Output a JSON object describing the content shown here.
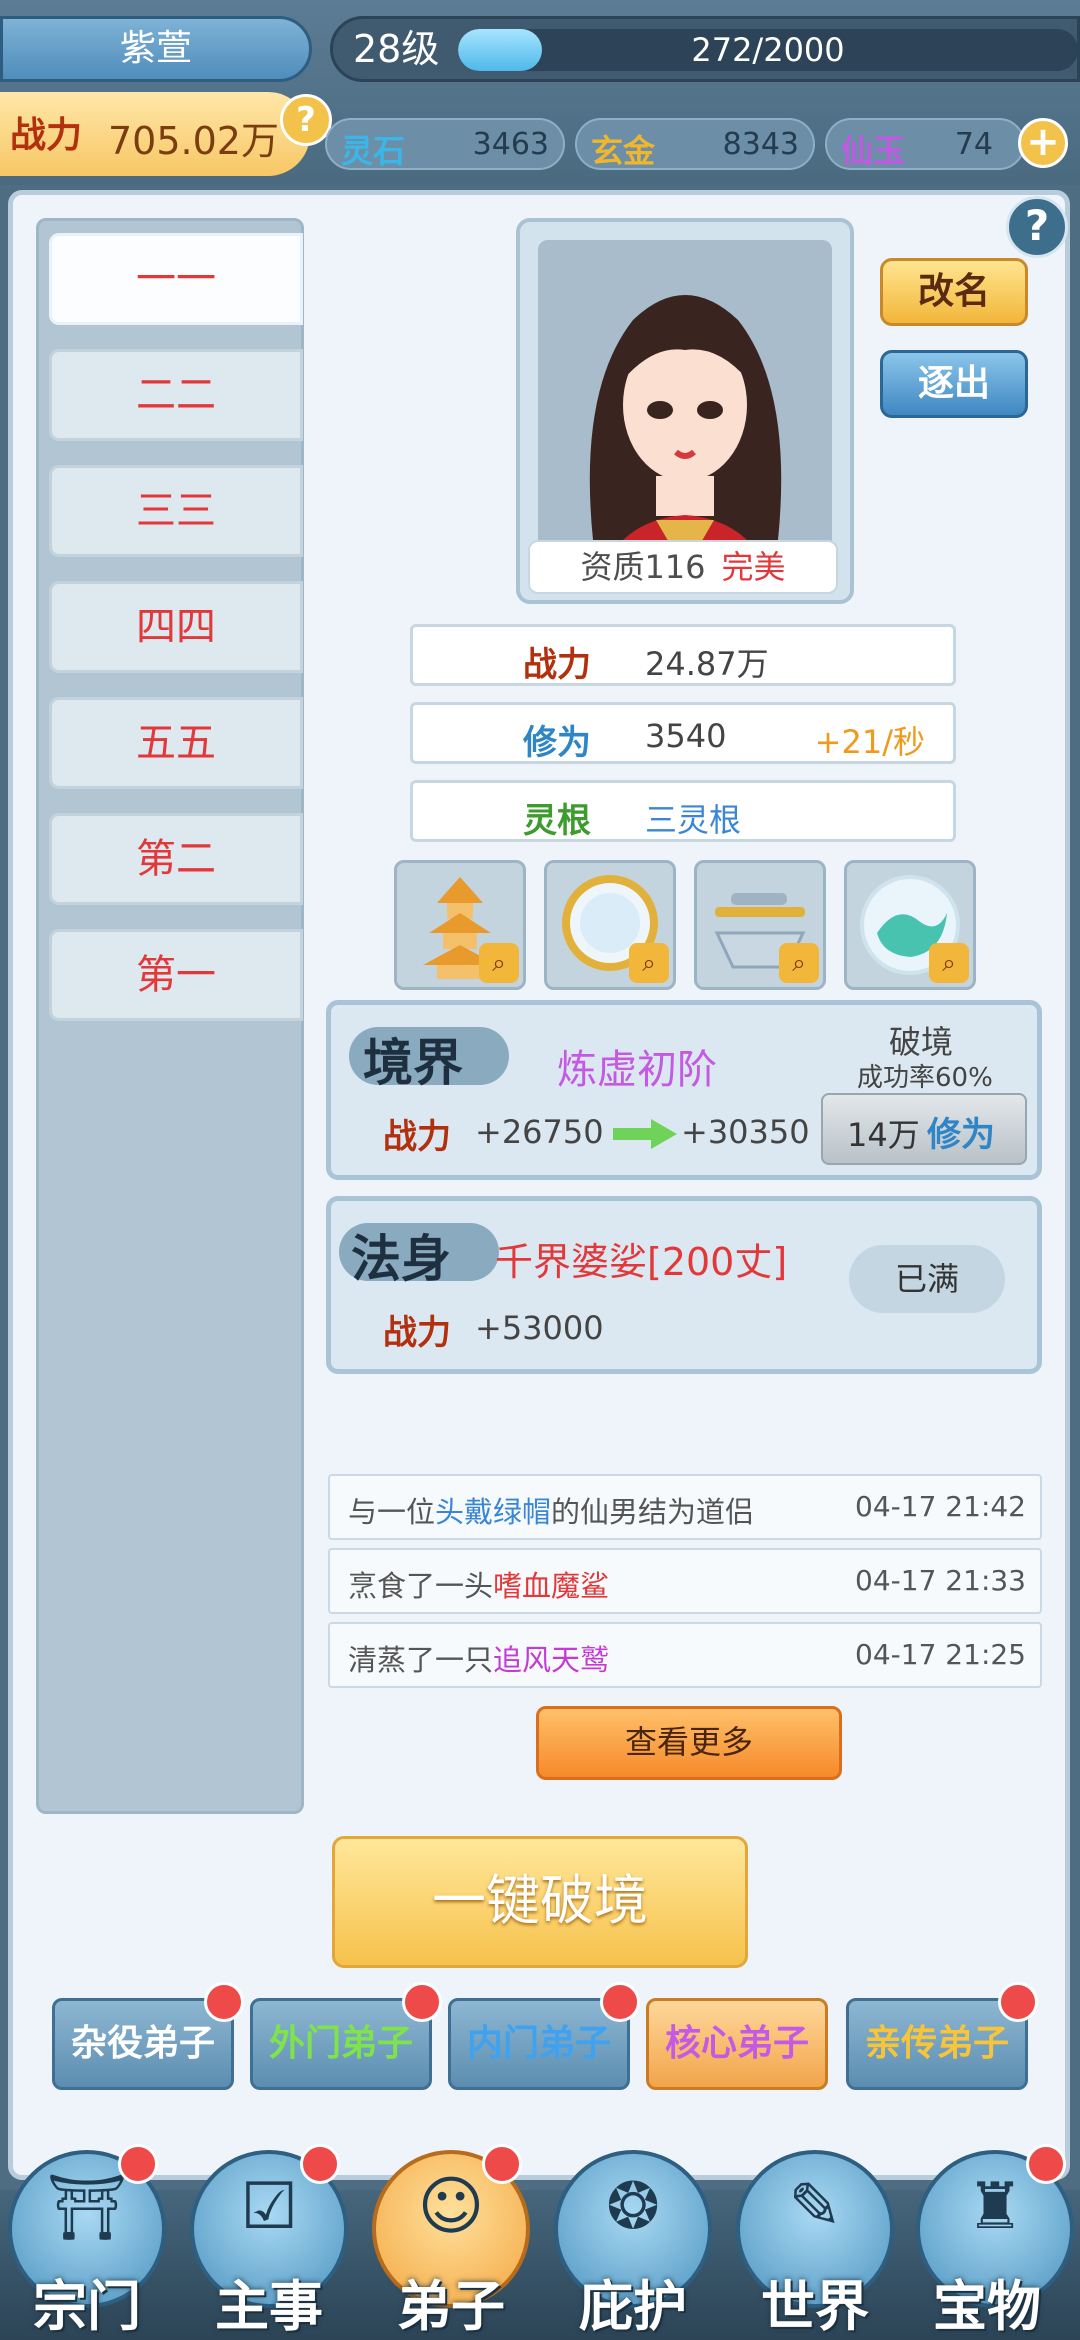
{
  "header": {
    "disciple_name": "紫萱",
    "level": "28级",
    "exp_text": "272/2000",
    "exp_fraction": 0.136,
    "power_label": "战力",
    "power_value": "705.02万",
    "help_icon": "?"
  },
  "resources": [
    {
      "name": "灵石",
      "value": "3463",
      "color": "#3bb6e8"
    },
    {
      "name": "玄金",
      "value": "8343",
      "color": "#f1b62c"
    },
    {
      "name": "仙玉",
      "value": "74",
      "color": "#c15ae3"
    }
  ],
  "resource_add": "+",
  "panel_help": "?",
  "sidebar": {
    "items": [
      {
        "label": "一一"
      },
      {
        "label": "二二"
      },
      {
        "label": "三三"
      },
      {
        "label": "四四"
      },
      {
        "label": "五五"
      },
      {
        "label": "第二"
      },
      {
        "label": "第一"
      }
    ]
  },
  "portrait": {
    "aptitude_label": "资质116",
    "aptitude_grade": "完美"
  },
  "actions": {
    "rename": "改名",
    "expel": "逐出"
  },
  "stats": {
    "power_label": "战力",
    "power_value": "24.87万",
    "cultivation_label": "修为",
    "cultivation_value": "3540",
    "cultivation_rate": "+21/秒",
    "root_label": "灵根",
    "root_value": "三灵根"
  },
  "treasures": [
    {
      "icon": "pagoda-icon"
    },
    {
      "icon": "mirror-icon"
    },
    {
      "icon": "sword-icon"
    },
    {
      "icon": "orb-icon"
    }
  ],
  "realm": {
    "title": "境界",
    "name": "炼虚初阶",
    "power_label": "战力",
    "power_from": "+26750",
    "power_to": "+30350",
    "break_label": "破境",
    "success_rate": "成功率60%",
    "cost_amount": "14万",
    "cost_unit": "修为"
  },
  "dharma_body": {
    "title": "法身",
    "name": "千界婆娑[200丈]",
    "power_label": "战力",
    "power_value": "+53000",
    "status": "已满"
  },
  "logs": [
    {
      "prefix": "与一位",
      "highlight": "头戴绿帽",
      "suffix": "的仙男结为道侣",
      "time": "04-17 21:42",
      "color": "#3a86d6"
    },
    {
      "prefix": "烹食了一头",
      "highlight": "嗜血魔鲨",
      "suffix": "",
      "time": "04-17 21:33",
      "color": "#e2383a"
    },
    {
      "prefix": "清蒸了一只",
      "highlight": "追风天鹫",
      "suffix": "",
      "time": "04-17 21:25",
      "color": "#c43ad6"
    }
  ],
  "view_more": "查看更多",
  "one_click_break": "一键破境",
  "disciple_tabs": [
    {
      "label": "杂役弟子",
      "color": "#ffffff"
    },
    {
      "label": "外门弟子",
      "color": "#7fe34a"
    },
    {
      "label": "内门弟子",
      "color": "#3ea2f0"
    },
    {
      "label": "核心弟子",
      "color": "#c45ae3"
    },
    {
      "label": "亲传弟子",
      "color": "#f7c43a"
    }
  ],
  "bottom_nav": [
    {
      "label": "宗门",
      "icon": "sect-icon"
    },
    {
      "label": "主事",
      "icon": "task-icon"
    },
    {
      "label": "弟子",
      "icon": "disciple-icon"
    },
    {
      "label": "庇护",
      "icon": "shelter-icon"
    },
    {
      "label": "世界",
      "icon": "world-icon"
    },
    {
      "label": "宝物",
      "icon": "treasure-bag-icon"
    }
  ]
}
